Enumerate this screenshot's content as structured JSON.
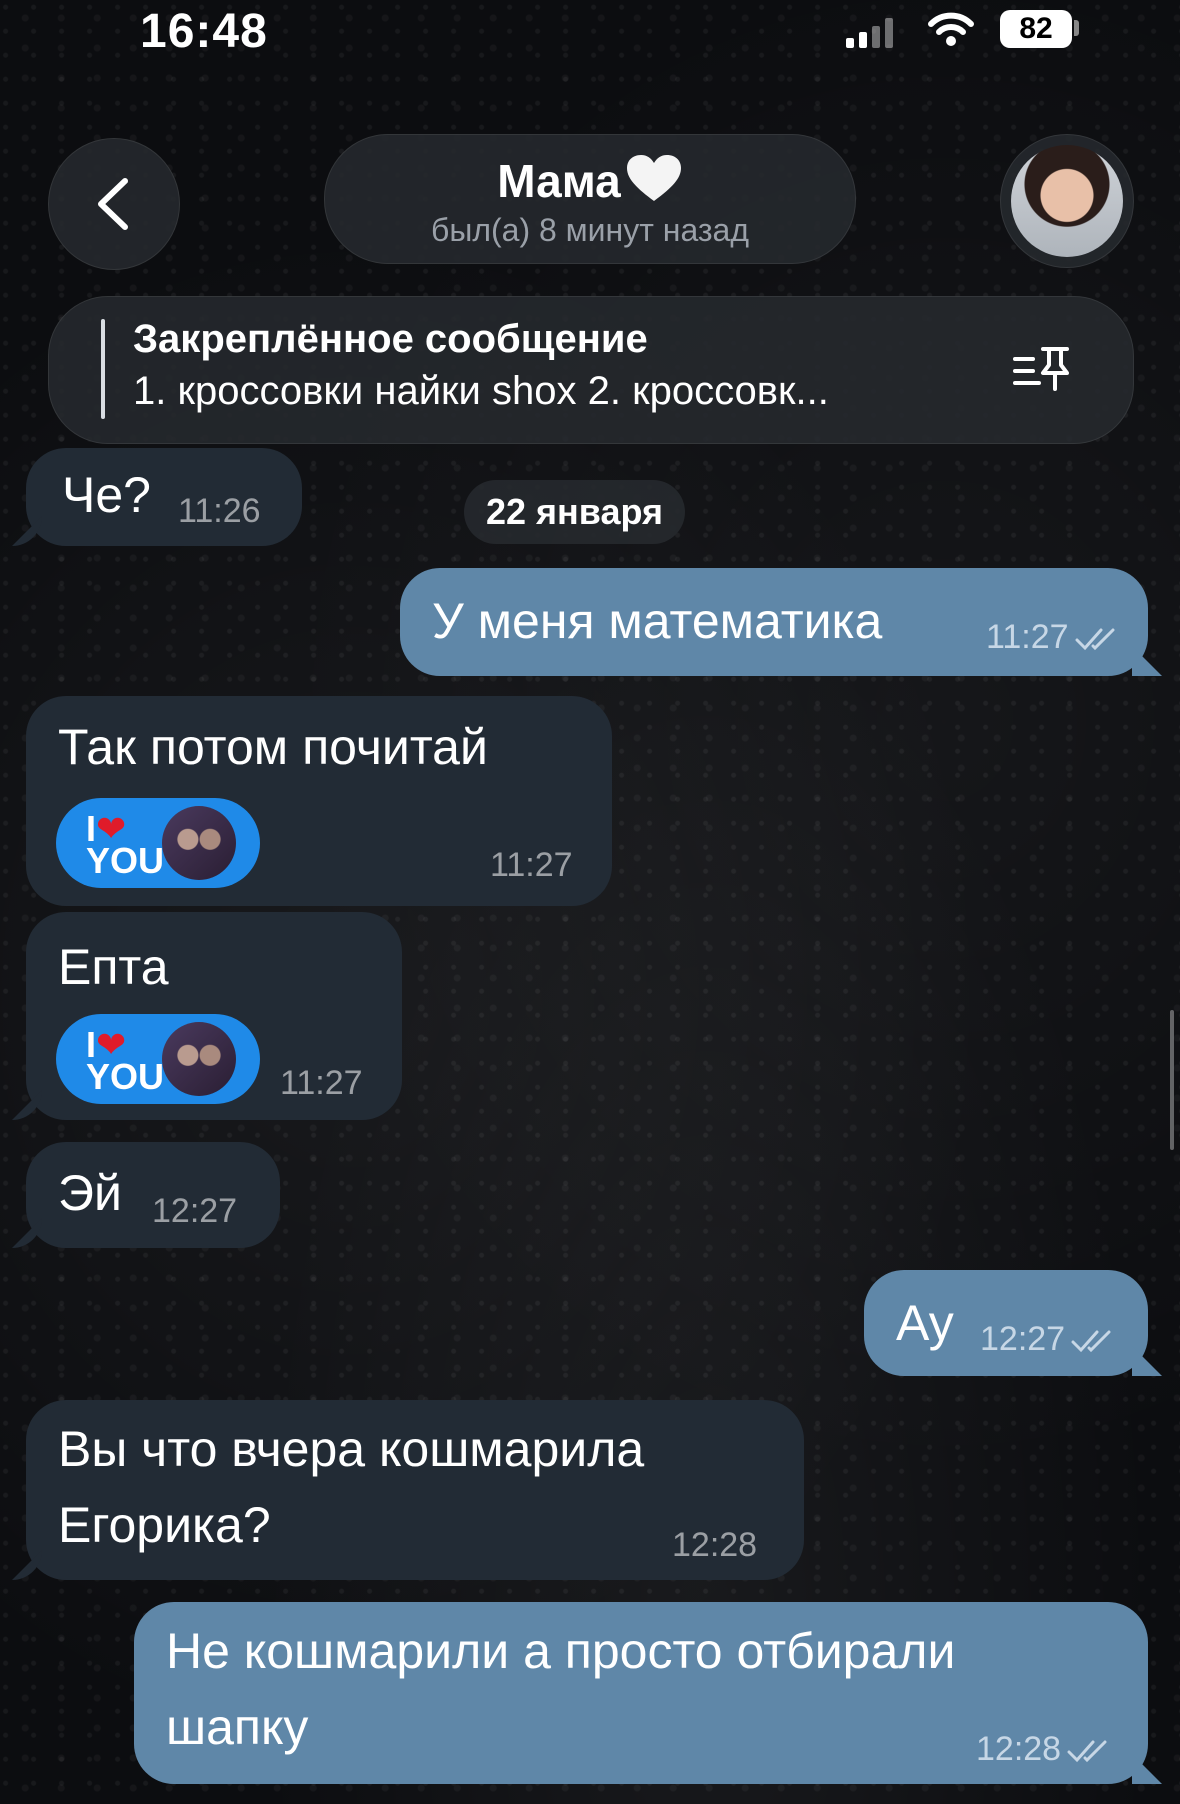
{
  "status": {
    "time": "16:48",
    "battery": "82"
  },
  "chat": {
    "title": "Мама",
    "subtitle": "был(а) 8 минут назад"
  },
  "pinned": {
    "title": "Закреплённое сообщение",
    "text": "1. кроссовки найки shox 2. кроссовк..."
  },
  "date_separator": "22 января",
  "messages": [
    {
      "dir": "in",
      "text": "Че?",
      "time": "11:26"
    },
    {
      "dir": "out",
      "text": "У меня математика",
      "time": "11:27"
    },
    {
      "dir": "in",
      "text": "Так потом почитай",
      "time": "11:27",
      "reaction": "I ❤ YOU"
    },
    {
      "dir": "in",
      "text": "Епта",
      "time": "11:27",
      "reaction": "I ❤ YOU"
    },
    {
      "dir": "in",
      "text": "Эй",
      "time": "12:27"
    },
    {
      "dir": "out",
      "text": "Ау",
      "time": "12:27"
    },
    {
      "dir": "in",
      "text_line1": "Вы что вчера кошмарила",
      "text_line2": "Егорика?",
      "time": "12:28"
    },
    {
      "dir": "out",
      "text_line1": "Не кошмарили а просто отбирали",
      "text_line2": "шапку",
      "time": "12:28"
    }
  ],
  "sticker": {
    "line1": "I",
    "line2": "YOU"
  },
  "icons": {
    "back": "chevron-left-icon",
    "pin": "pin-list-icon",
    "read": "double-check-icon"
  }
}
